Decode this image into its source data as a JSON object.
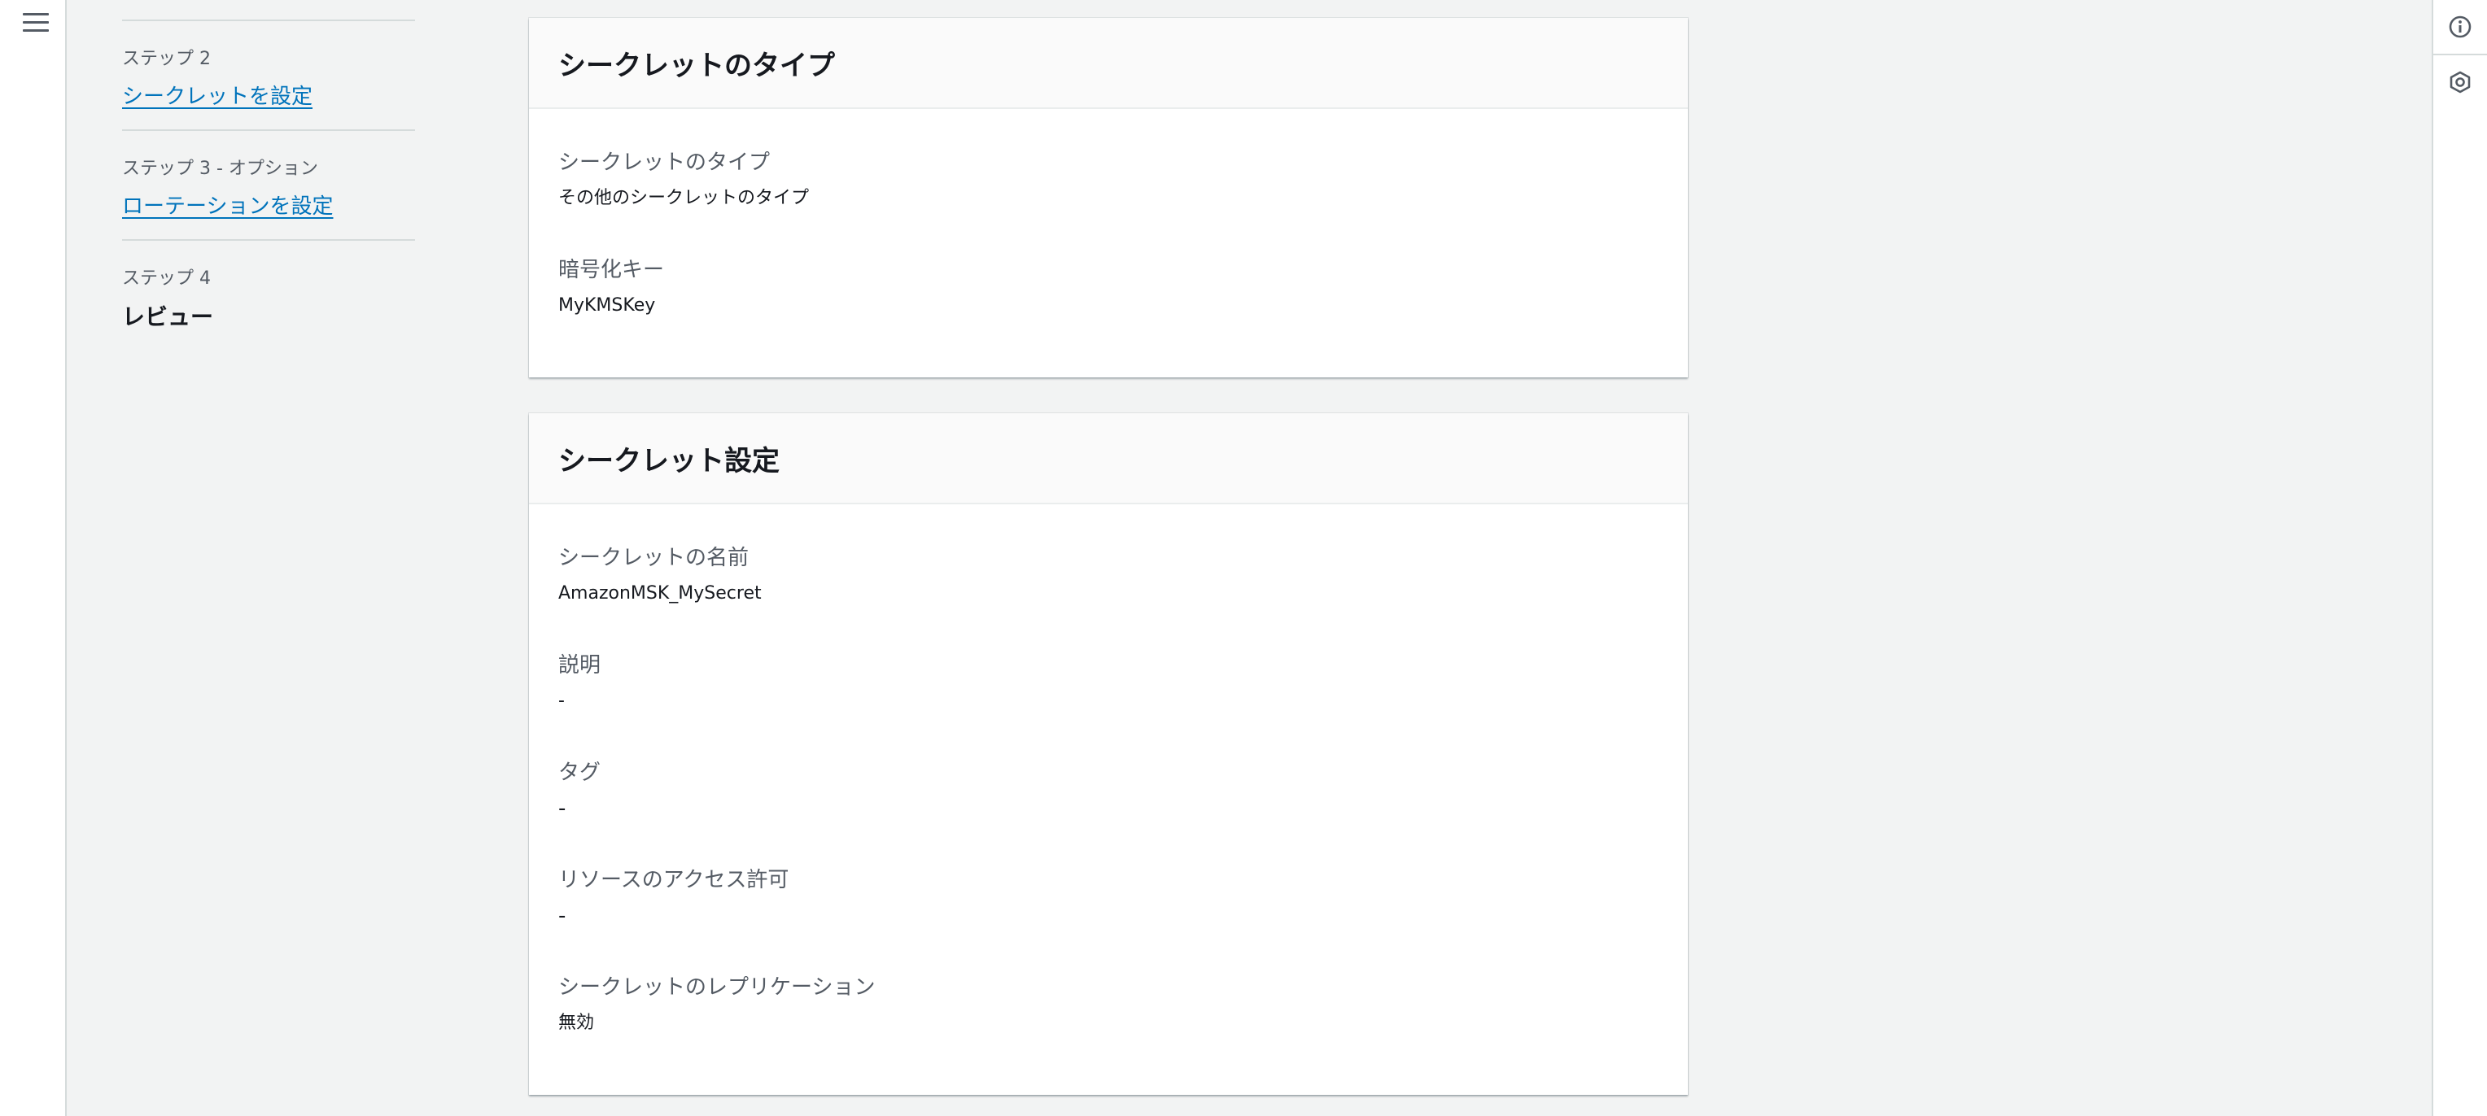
{
  "steps": [
    {
      "label": "ステップ 2",
      "title": "シークレットを設定"
    },
    {
      "label": "ステップ 3 - オプション",
      "title": "ローテーションを設定"
    },
    {
      "label": "ステップ 4",
      "title": "レビュー"
    }
  ],
  "secret_type_section": {
    "title": "シークレットのタイプ",
    "fields": [
      {
        "key": "シークレットのタイプ",
        "value": "その他のシークレットのタイプ"
      },
      {
        "key": "暗号化キー",
        "value": "MyKMSKey"
      }
    ]
  },
  "secret_settings_section": {
    "title": "シークレット設定",
    "fields": [
      {
        "key": "シークレットの名前",
        "value": "AmazonMSK_MySecret"
      },
      {
        "key": "説明",
        "value": "-"
      },
      {
        "key": "タグ",
        "value": "-"
      },
      {
        "key": "リソースのアクセス許可",
        "value": "-"
      },
      {
        "key": "シークレットのレプリケーション",
        "value": "無効"
      }
    ]
  },
  "icons": {
    "menu": "hamburger-menu-icon",
    "info": "info-icon",
    "help": "help-hexagon-icon"
  }
}
